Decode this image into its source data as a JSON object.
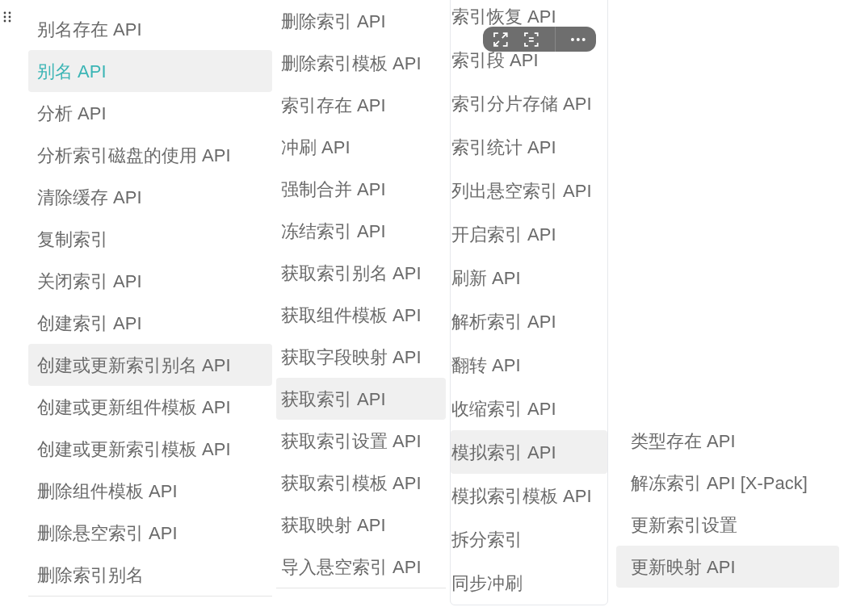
{
  "columns": [
    {
      "items": [
        {
          "label": "别名存在 API",
          "selected": false,
          "hovered": false
        },
        {
          "label": "别名 API",
          "selected": true,
          "hovered": false
        },
        {
          "label": "分析 API",
          "selected": false,
          "hovered": false
        },
        {
          "label": "分析索引磁盘的使用 API",
          "selected": false,
          "hovered": false
        },
        {
          "label": "清除缓存 API",
          "selected": false,
          "hovered": false
        },
        {
          "label": "复制索引",
          "selected": false,
          "hovered": false
        },
        {
          "label": "关闭索引 API",
          "selected": false,
          "hovered": false
        },
        {
          "label": "创建索引 API",
          "selected": false,
          "hovered": false
        },
        {
          "label": "创建或更新索引别名 API",
          "selected": false,
          "hovered": true
        },
        {
          "label": "创建或更新组件模板 API",
          "selected": false,
          "hovered": false
        },
        {
          "label": "创建或更新索引模板 API",
          "selected": false,
          "hovered": false
        },
        {
          "label": "删除组件模板 API",
          "selected": false,
          "hovered": false
        },
        {
          "label": "删除悬空索引 API",
          "selected": false,
          "hovered": false
        },
        {
          "label": "删除索引别名",
          "selected": false,
          "hovered": false
        }
      ]
    },
    {
      "items": [
        {
          "label": "删除索引 API",
          "selected": false,
          "hovered": false
        },
        {
          "label": "删除索引模板 API",
          "selected": false,
          "hovered": false
        },
        {
          "label": "索引存在 API",
          "selected": false,
          "hovered": false
        },
        {
          "label": "冲刷 API",
          "selected": false,
          "hovered": false
        },
        {
          "label": "强制合并 API",
          "selected": false,
          "hovered": false
        },
        {
          "label": "冻结索引 API",
          "selected": false,
          "hovered": false
        },
        {
          "label": "获取索引别名 API",
          "selected": false,
          "hovered": false
        },
        {
          "label": "获取组件模板 API",
          "selected": false,
          "hovered": false
        },
        {
          "label": "获取字段映射 API",
          "selected": false,
          "hovered": false
        },
        {
          "label": "获取索引 API",
          "selected": false,
          "hovered": true
        },
        {
          "label": "获取索引设置 API",
          "selected": false,
          "hovered": false
        },
        {
          "label": "获取索引模板 API",
          "selected": false,
          "hovered": false
        },
        {
          "label": "获取映射 API",
          "selected": false,
          "hovered": false
        },
        {
          "label": "导入悬空索引 API",
          "selected": false,
          "hovered": false
        }
      ]
    },
    {
      "items": [
        {
          "label": "索引恢复 API",
          "selected": false,
          "hovered": false
        },
        {
          "label": "索引段 API",
          "selected": false,
          "hovered": false
        },
        {
          "label": "索引分片存储 API",
          "selected": false,
          "hovered": false
        },
        {
          "label": "索引统计 API",
          "selected": false,
          "hovered": false
        },
        {
          "label": "列出悬空索引 API",
          "selected": false,
          "hovered": false
        },
        {
          "label": "开启索引 API",
          "selected": false,
          "hovered": false
        },
        {
          "label": "刷新 API",
          "selected": false,
          "hovered": false
        },
        {
          "label": "解析索引 API",
          "selected": false,
          "hovered": false
        },
        {
          "label": "翻转 API",
          "selected": false,
          "hovered": false
        },
        {
          "label": "收缩索引 API",
          "selected": false,
          "hovered": false
        },
        {
          "label": "模拟索引 API",
          "selected": false,
          "hovered": true
        },
        {
          "label": "模拟索引模板 API",
          "selected": false,
          "hovered": false
        },
        {
          "label": "拆分索引",
          "selected": false,
          "hovered": false
        },
        {
          "label": "同步冲刷",
          "selected": false,
          "hovered": false
        }
      ]
    },
    {
      "items": [
        {
          "label": "类型存在 API",
          "selected": false,
          "hovered": false
        },
        {
          "label": "解冻索引 API [X-Pack]",
          "selected": false,
          "hovered": false
        },
        {
          "label": "更新索引设置",
          "selected": false,
          "hovered": false
        },
        {
          "label": "更新映射 API",
          "selected": false,
          "hovered": true
        }
      ]
    }
  ]
}
